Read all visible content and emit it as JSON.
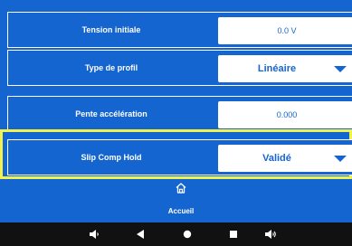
{
  "params": [
    {
      "label": "Tension initiale",
      "value": "0.0 V"
    },
    {
      "label": "Type de profil",
      "value": "Linéaire"
    },
    {
      "label": "Pente accélération",
      "value": "0.000"
    },
    {
      "label": "Slip Comp Hold",
      "value": "Validé"
    }
  ],
  "footer": {
    "home_label": "Accueil"
  },
  "nav": [
    {
      "icon": "volume-down-icon"
    },
    {
      "icon": "back-icon"
    },
    {
      "icon": "home-dot-icon"
    },
    {
      "icon": "recents-icon"
    },
    {
      "icon": "volume-up-icon"
    }
  ],
  "colors": {
    "background": "#1565d0",
    "highlight": "#f2f24a",
    "navbar": "#111111",
    "field": "#ffffff"
  }
}
